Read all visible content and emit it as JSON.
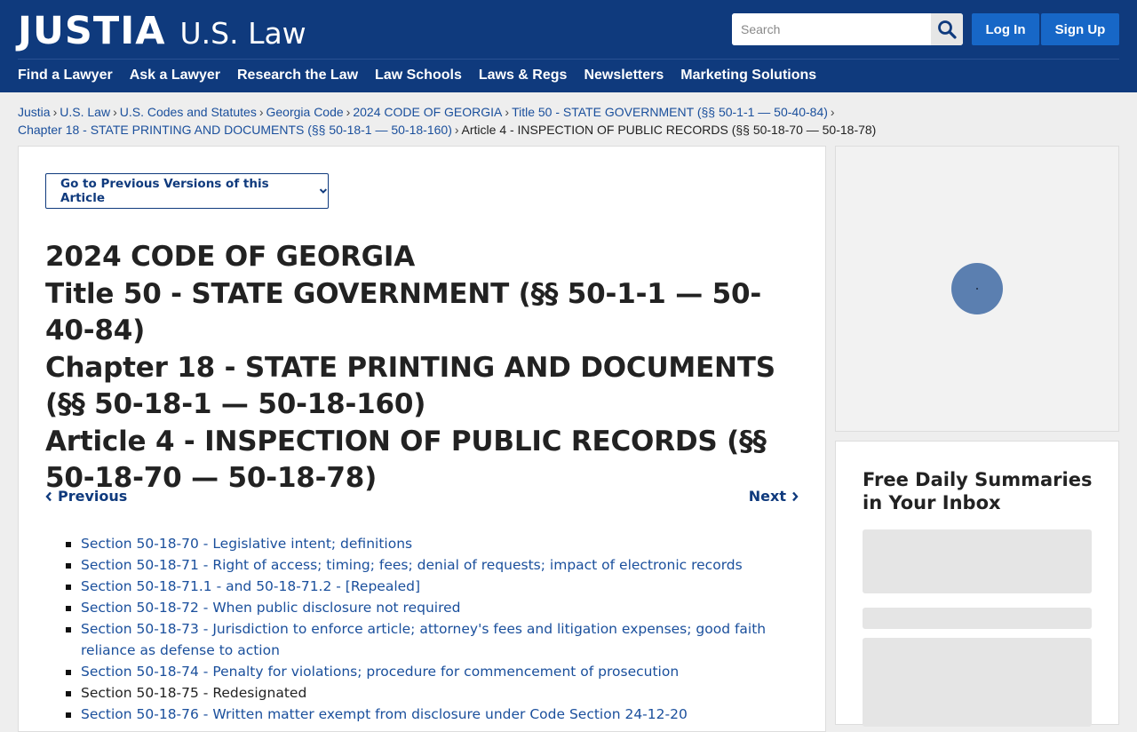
{
  "header": {
    "logo_main": "JUSTIA",
    "logo_sub": "U.S. Law",
    "search_placeholder": "Search",
    "login_label": "Log In",
    "signup_label": "Sign Up",
    "brand_color": "#0f3a7d",
    "button_color": "#1767c7"
  },
  "nav": {
    "items": [
      "Find a Lawyer",
      "Ask a Lawyer",
      "Research the Law",
      "Law Schools",
      "Laws & Regs",
      "Newsletters",
      "Marketing Solutions"
    ]
  },
  "breadcrumb": {
    "links": [
      "Justia",
      "U.S. Law",
      "U.S. Codes and Statutes",
      "Georgia Code",
      "2024 CODE OF GEORGIA",
      "Title 50 - STATE GOVERNMENT (§§ 50-1-1 — 50-40-84)",
      "Chapter 18 - STATE PRINTING AND DOCUMENTS (§§ 50-18-1 — 50-18-160)"
    ],
    "current": "Article 4 - INSPECTION OF PUBLIC RECORDS (§§ 50-18-70 — 50-18-78)",
    "separator": "›"
  },
  "main": {
    "versions_button": "Go to Previous Versions of this Article",
    "title_lines": [
      "2024 CODE OF GEORGIA",
      "Title 50 - STATE GOVERNMENT (§§ 50-1-1 — 50-40-84)",
      "Chapter 18 - STATE PRINTING AND DOCUMENTS (§§ 50-18-1 — 50-18-160)",
      "Article 4 - INSPECTION OF PUBLIC RECORDS (§§ 50-18-70 — 50-18-78)"
    ],
    "previous_label": "Previous",
    "next_label": "Next",
    "sections": [
      {
        "text": "Section 50-18-70 - Legislative intent; definitions",
        "link": true
      },
      {
        "text": "Section 50-18-71 - Right of access; timing; fees; denial of requests; impact of electronic records",
        "link": true
      },
      {
        "text": "Section 50-18-71.1 - and 50-18-71.2 - [Repealed]",
        "link": true
      },
      {
        "text": "Section 50-18-72 - When public disclosure not required",
        "link": true
      },
      {
        "text": "Section 50-18-73 - Jurisdiction to enforce article; attorney's fees and litigation expenses; good faith reliance as defense to action",
        "link": true
      },
      {
        "text": "Section 50-18-74 - Penalty for violations; procedure for commencement of prosecution",
        "link": true
      },
      {
        "text": "Section 50-18-75 - Redesignated",
        "link": false
      },
      {
        "text": "Section 50-18-76 - Written matter exempt from disclosure under Code Section 24-12-20",
        "link": true
      }
    ]
  },
  "sidebar": {
    "summary_title": "Free Daily Summaries in Your Inbox"
  }
}
